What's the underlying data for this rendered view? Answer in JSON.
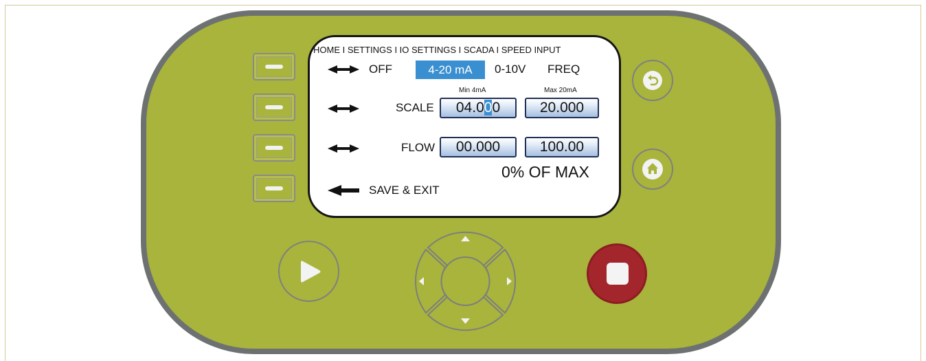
{
  "breadcrumb": "HOME I SETTINGS I IO SETTINGS I SCADA I SPEED INPUT",
  "mode_options": {
    "off": "OFF",
    "ma": "4-20 mA",
    "volt": "0-10V",
    "freq": "FREQ",
    "selected": "4-20 mA"
  },
  "scale": {
    "label": "SCALE",
    "min_caption": "Min 4mA",
    "max_caption": "Max 20mA",
    "min_prefix": "04.0",
    "min_cursor": "0",
    "min_suffix": "0",
    "max_value": "20.000"
  },
  "flow": {
    "label": "FLOW",
    "min_value": "00.000",
    "max_value": "100.00",
    "status": "0% OF MAX"
  },
  "save_exit": "SAVE & EXIT",
  "icons": {
    "back": "back-arrow-icon",
    "home": "home-icon",
    "play": "play-icon",
    "stop": "stop-icon",
    "up": "up-triangle-icon",
    "down": "down-triangle-icon",
    "left": "left-triangle-icon",
    "right": "right-triangle-icon"
  },
  "colors": {
    "device_body": "#a8b43c",
    "device_border": "#6e7171",
    "selection": "#3a8fd1",
    "stop_button": "#a3262c"
  }
}
